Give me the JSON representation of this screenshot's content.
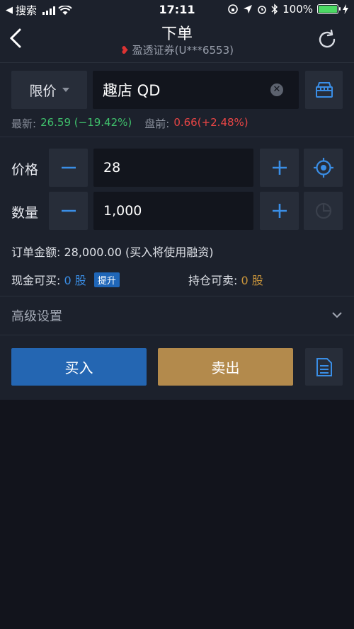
{
  "status_bar": {
    "back_app": "搜索",
    "time": "17:11",
    "battery": "100%"
  },
  "header": {
    "title": "下单",
    "broker": "盈透证券(U***6553)"
  },
  "order_type": {
    "selected": "限价"
  },
  "stock": {
    "name": "趣店 QD"
  },
  "quote": {
    "latest_label": "最新:",
    "latest_value": "26.59 (−19.42%)",
    "premarket_label": "盘前:",
    "premarket_value": "0.66(+2.48%)"
  },
  "price": {
    "label": "价格",
    "value": "28"
  },
  "quantity": {
    "label": "数量",
    "value": "1,000"
  },
  "order_amount": "订单金额: 28,000.00 (买入将使用融资)",
  "cash_buy": {
    "label": "现金可买:",
    "value": "0 股",
    "badge": "提升"
  },
  "position_sell": {
    "label": "持仓可卖:",
    "value": "0 股"
  },
  "advanced": {
    "label": "高级设置"
  },
  "actions": {
    "buy": "买入",
    "sell": "卖出"
  },
  "colors": {
    "up": "#e84545",
    "down": "#3fbf6b",
    "buy": "#2466b2",
    "sell": "#b38a4c",
    "accent": "#3a8ee6"
  }
}
